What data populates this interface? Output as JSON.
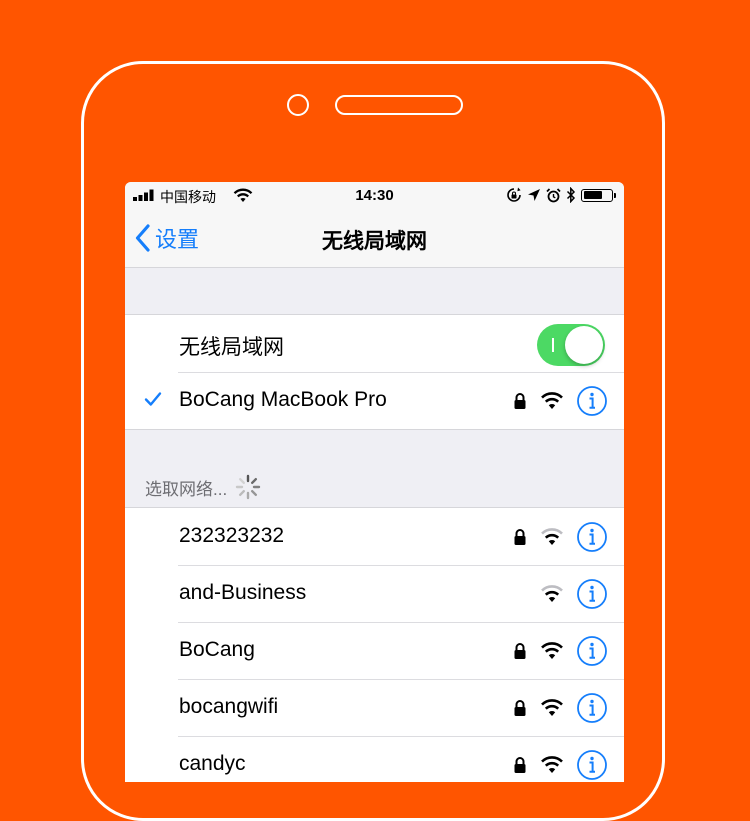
{
  "colors": {
    "background": "#FF5500",
    "accent": "#157EFB",
    "toggle_on": "#4CD964"
  },
  "status_bar": {
    "carrier": "中国移动",
    "time": "14:30"
  },
  "nav": {
    "back_label": "设置",
    "title": "无线局域网"
  },
  "wlan": {
    "toggle_label": "无线局域网",
    "enabled": true,
    "connected_network": "BoCang MacBook Pro"
  },
  "section_header": "选取网络...",
  "networks": [
    {
      "name": "232323232",
      "locked": true,
      "signal": "medium"
    },
    {
      "name": "and-Business",
      "locked": false,
      "signal": "medium"
    },
    {
      "name": "BoCang",
      "locked": true,
      "signal": "full"
    },
    {
      "name": "bocangwifi",
      "locked": true,
      "signal": "full"
    },
    {
      "name": "candyc",
      "locked": true,
      "signal": "full"
    }
  ]
}
